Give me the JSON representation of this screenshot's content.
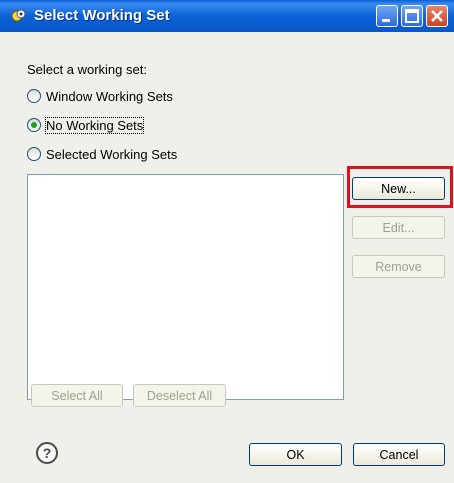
{
  "window": {
    "title": "Select Working Set"
  },
  "dialog": {
    "prompt": "Select a working set:",
    "options": [
      {
        "label": "Window Working Sets",
        "selected": false
      },
      {
        "label": "No Working Sets",
        "selected": true
      },
      {
        "label": "Selected Working Sets",
        "selected": false
      }
    ],
    "side_buttons": {
      "new": "New...",
      "edit": "Edit...",
      "remove": "Remove"
    },
    "list_buttons": {
      "select_all": "Select All",
      "deselect_all": "Deselect All"
    },
    "footer": {
      "ok": "OK",
      "cancel": "Cancel"
    }
  },
  "icons": {
    "title": "working-set-icon",
    "help": "help-icon"
  },
  "colors": {
    "titlebar": "#0a5fd7",
    "highlight": "#e0101d",
    "dialog_bg": "#f0f0ea"
  }
}
